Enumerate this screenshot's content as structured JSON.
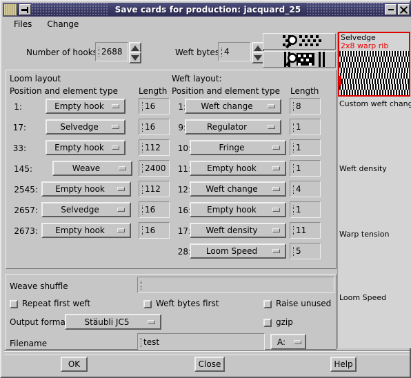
{
  "window": {
    "title": "Save cards for production: jacquard_25",
    "app_icon": "cards-icon",
    "pin_icon": "pin-icon",
    "minimize_icon": "minimize-icon",
    "close_icon": "close-icon"
  },
  "menubar": {
    "items": [
      {
        "label": "Files",
        "name": "menu-files"
      },
      {
        "label": "Change",
        "name": "menu-change"
      }
    ]
  },
  "toolbar": {
    "hooks_label": "Number of hooks",
    "hooks_value": "2688",
    "weft_bytes_label": "Weft bytes",
    "weft_bytes_value": "4",
    "zoom_warp_icon": "magnifier-warp-icon",
    "zoom_weft_icon": "magnifier-weft-icon"
  },
  "loom": {
    "section_title": "Loom layout",
    "col_position": "Position and element type",
    "col_length": "Length",
    "rows": [
      {
        "position": "1:",
        "type": "Empty hook",
        "length": "16"
      },
      {
        "position": "17:",
        "type": "Selvedge",
        "length": "16"
      },
      {
        "position": "33:",
        "type": "Empty hook",
        "length": "112"
      },
      {
        "position": "145:",
        "type": "Weave",
        "length": "2400"
      },
      {
        "position": "2545:",
        "type": "Empty hook",
        "length": "112"
      },
      {
        "position": "2657:",
        "type": "Selvedge",
        "length": "16"
      },
      {
        "position": "2673:",
        "type": "Empty hook",
        "length": "16"
      }
    ]
  },
  "weft": {
    "section_title": "Weft layout:",
    "col_position": "Position and element type",
    "col_length": "Length",
    "rows": [
      {
        "position": "1:",
        "type": "Weft change",
        "length": "8"
      },
      {
        "position": "9:",
        "type": "Regulator",
        "length": "1"
      },
      {
        "position": "10:",
        "type": "Fringe",
        "length": "1"
      },
      {
        "position": "11:",
        "type": "Empty hook",
        "length": "1"
      },
      {
        "position": "12:",
        "type": "Weft change",
        "length": "4"
      },
      {
        "position": "16:",
        "type": "Empty hook",
        "length": "1"
      },
      {
        "position": "17:",
        "type": "Weft density",
        "length": "11"
      },
      {
        "position": "28:",
        "type": "Loom Speed",
        "length": "5"
      }
    ]
  },
  "options": {
    "weave_shuffle_label": "Weave shuffle",
    "weave_shuffle_value": "",
    "checkboxes": [
      {
        "label": "Repeat first weft",
        "name": "checkbox-repeat-first-weft",
        "checked": false
      },
      {
        "label": "Weft bytes first",
        "name": "checkbox-weft-bytes-first",
        "checked": false
      },
      {
        "label": "Raise unused",
        "name": "checkbox-raise-unused",
        "checked": false
      },
      {
        "label": "gzip",
        "name": "checkbox-gzip",
        "checked": false
      }
    ],
    "output_format_label": "Output format",
    "output_format_value": "Stäubli JC5",
    "filename_label": "Filename",
    "filename_value": "test",
    "drive_value": "A:"
  },
  "sidebar": {
    "preview_title": "Selvedge",
    "preview_subtitle": "2x8 warp rib",
    "labels": [
      {
        "text": "Custom weft change",
        "name": "sidebar-label-custom-weft-change"
      },
      {
        "text": "Weft density",
        "name": "sidebar-label-weft-density"
      },
      {
        "text": "Warp tension",
        "name": "sidebar-label-warp-tension"
      },
      {
        "text": "Loom Speed",
        "name": "sidebar-label-loom-speed"
      }
    ]
  },
  "actions": {
    "ok": "OK",
    "close": "Close",
    "help": "Help"
  },
  "colors": {
    "face": "#c6c6c6",
    "title_bar": "#3b3b66",
    "accent_red": "#ee0000",
    "sidebar": "#d4d4d4"
  }
}
